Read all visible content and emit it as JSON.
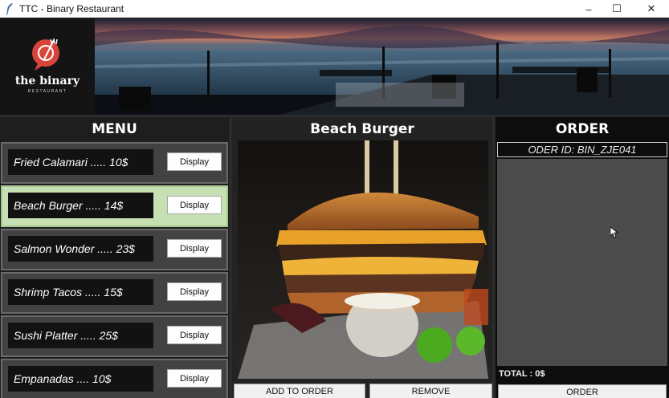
{
  "window": {
    "title": "TTC - Binary Restaurant",
    "minimize": "–",
    "maximize": "☐",
    "close": "✕"
  },
  "logo": {
    "name": "the binary",
    "tagline": "RESTAURANT"
  },
  "menu": {
    "title": "MENU",
    "items": [
      {
        "label": "Fried Calamari ..... 10$",
        "button": "Display",
        "selected": false
      },
      {
        "label": "Beach Burger ..... 14$",
        "button": "Display",
        "selected": true
      },
      {
        "label": "Salmon Wonder ..... 23$",
        "button": "Display",
        "selected": false
      },
      {
        "label": "Shrimp Tacos ..... 15$",
        "button": "Display",
        "selected": false
      },
      {
        "label": "Sushi Platter ..... 25$",
        "button": "Display",
        "selected": false
      },
      {
        "label": "Empanadas .... 10$",
        "button": "Display",
        "selected": false
      }
    ]
  },
  "detail": {
    "title": "Beach Burger",
    "add_button": "ADD TO ORDER",
    "remove_button": "REMOVE"
  },
  "order": {
    "title": "ORDER",
    "order_id": "ODER ID: BIN_ZJE041",
    "total": "TOTAL : 0$",
    "order_button": "ORDER"
  },
  "colors": {
    "selected_item": "#c7e0b3",
    "panel_dark": "#1a1a1a",
    "order_body": "#4b4b4b"
  }
}
